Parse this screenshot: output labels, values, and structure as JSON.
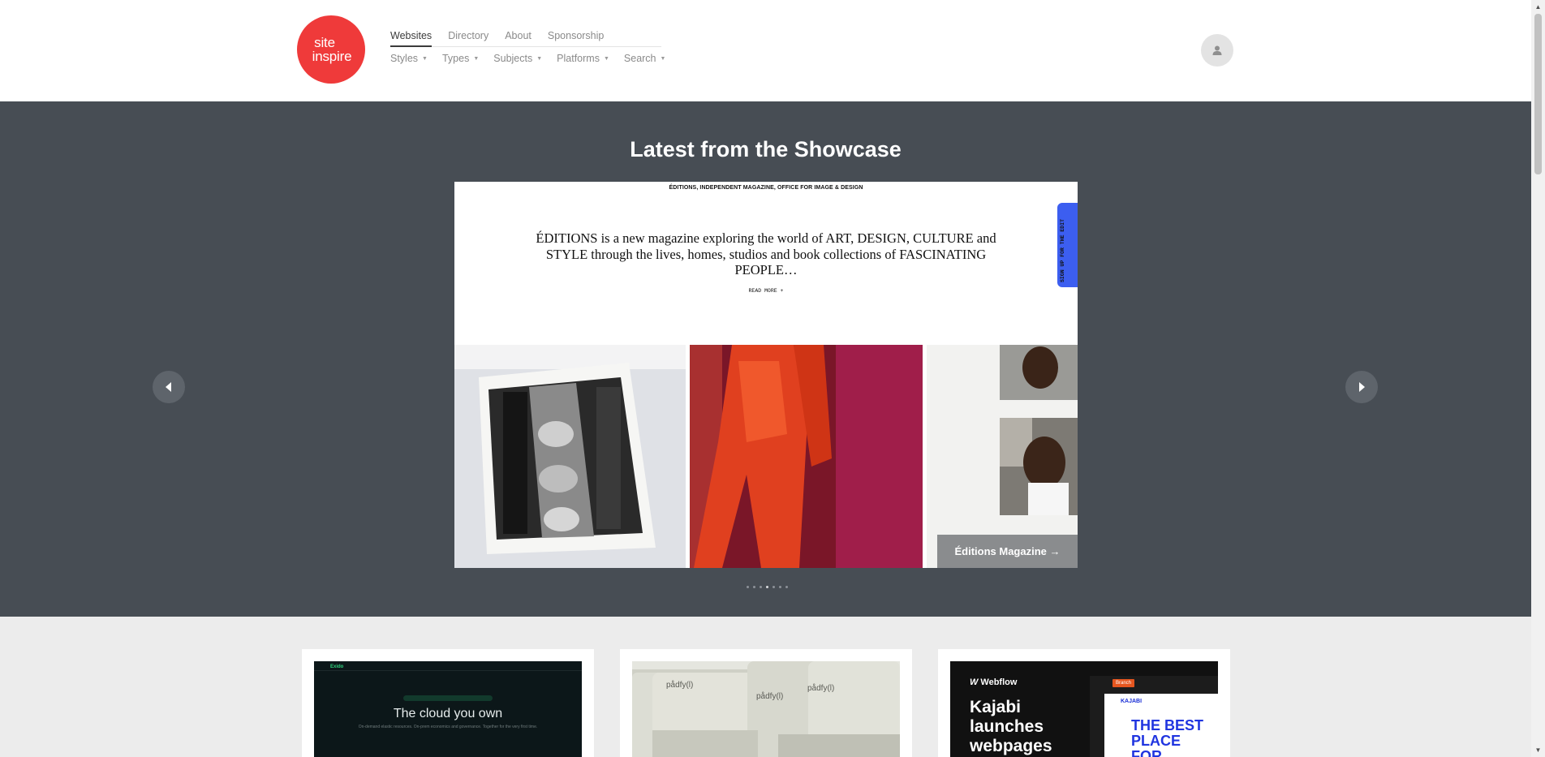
{
  "logo": {
    "line1": "site",
    "line2": "inspire",
    "color": "#ef3a3a"
  },
  "nav": {
    "primary": [
      {
        "label": "Websites",
        "active": true
      },
      {
        "label": "Directory"
      },
      {
        "label": "About"
      },
      {
        "label": "Sponsorship"
      }
    ],
    "secondary": [
      {
        "label": "Styles"
      },
      {
        "label": "Types"
      },
      {
        "label": "Subjects"
      },
      {
        "label": "Platforms"
      },
      {
        "label": "Search"
      }
    ]
  },
  "showcase": {
    "title": "Latest from the Showcase",
    "slide": {
      "topline": "ÉDITIONS, INDEPENDENT MAGAZINE, OFFICE FOR IMAGE & DESIGN",
      "body": "ÉDITIONS is a new magazine exploring the world of ART, DESIGN, CULTURE and STYLE through the lives, homes, studios and book collections of FASCINATING PEOPLE…",
      "read_more": "READ MORE +",
      "side_tab": "SIGN UP FOR THE EDIT",
      "caption": "Éditions Magazine →"
    },
    "dots_count": 7,
    "active_dot": 3
  },
  "cards": [
    {
      "brand": "Exido",
      "headline": "The cloud you own",
      "sub": "On-demand elastic resources. On-prem economics and governance. Together for the very first time."
    },
    {
      "brand": "pådfy(l)",
      "key_labels": [
        "pådfy(l)",
        "pådfy(l)",
        "pådfy(l)"
      ]
    },
    {
      "brand": "Webflow",
      "headline": "Kajabi launches webpages",
      "branch_label": "Branch",
      "kajabi": "KAJABI",
      "best": "THE BEST PLACE FOR CREATORS"
    }
  ],
  "colors": {
    "showcase_bg": "#474d54",
    "page_bg": "#ececec",
    "accent_blue": "#3c5ef0"
  }
}
